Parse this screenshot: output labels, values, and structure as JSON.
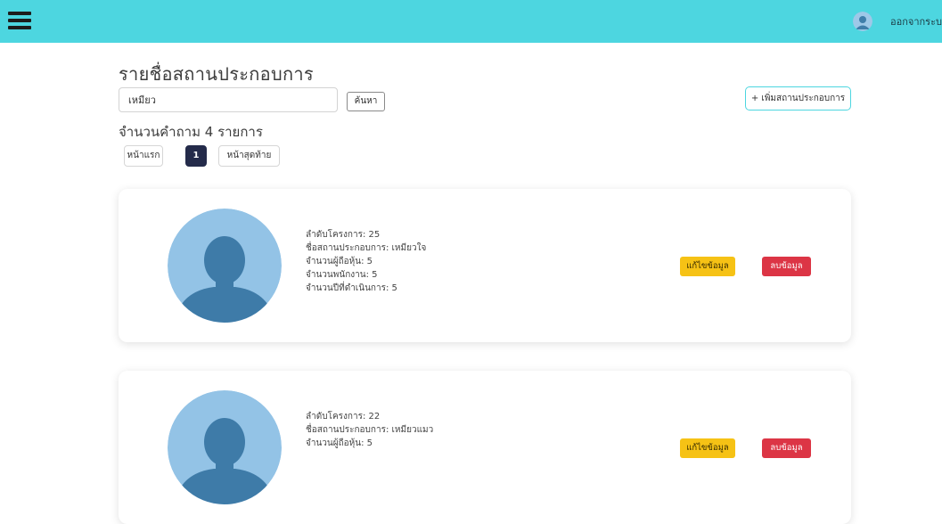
{
  "header": {
    "logout_label": "ออกจากระบบ",
    "accent_color": "#4dd6e0"
  },
  "page": {
    "title": "รายชื่อสถานประกอบการ",
    "result_count": "จำนวนคำถาม 4 รายการ"
  },
  "search": {
    "value": "เหมียว",
    "button_label": "ค้นหา"
  },
  "add_button_label": "+ เพิ่มสถานประกอบการ",
  "pagination": {
    "first_label": "หน้าแรก",
    "current_page": "1",
    "last_label": "หน้าสุดท้าย"
  },
  "cards": [
    {
      "project_no": "ลำดับโครงการ: 25",
      "name": "ชื่อสถานประกอบการ: เหมียวใจ",
      "shareholders": "จำนวนผู้ถือหุ้น: 5",
      "employees": "จำนวนพนักงาน: 5",
      "years": "จำนวนปีที่ดำเนินการ: 5",
      "edit_label": "แก้ไขข้อมูล",
      "delete_label": "ลบข้อมูล"
    },
    {
      "project_no": "ลำดับโครงการ: 22",
      "name": "ชื่อสถานประกอบการ: เหมียวแมว",
      "shareholders": "จำนวนผู้ถือหุ้น: 5",
      "edit_label": "แก้ไขข้อมูล",
      "delete_label": "ลบข้อมูล"
    }
  ]
}
